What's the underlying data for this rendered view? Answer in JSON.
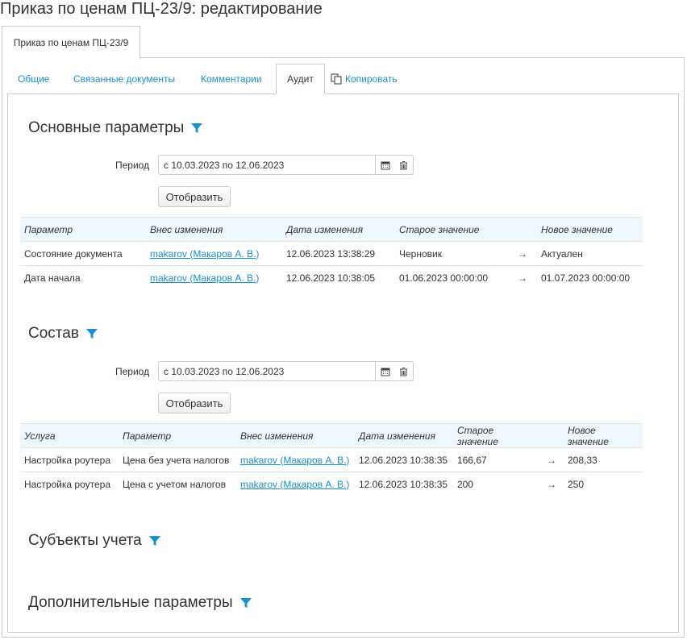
{
  "page_title": "Приказ по ценам ПЦ-23/9: редактирование",
  "outer_tab": "Приказ по ценам ПЦ-23/9",
  "tabs": [
    "Общие",
    "Связанные документы",
    "Комментарии",
    "Аудит",
    "Копировать"
  ],
  "active_tab": "Аудит",
  "sections": {
    "main_params": {
      "title": "Основные параметры",
      "period_label": "Период",
      "period_value": "с 10.03.2023 по 12.06.2023",
      "show_button": "Отобразить",
      "columns": [
        "Параметр",
        "Внес изменения",
        "Дата изменения",
        "Старое значение",
        "",
        "Новое значение"
      ],
      "rows": [
        [
          "Состояние документа",
          "makarov (Макаров А. В.)",
          "12.06.2023 13:38:29",
          "Черновик",
          "→",
          "Актуален"
        ],
        [
          "Дата начала",
          "makarov (Макаров А. В.)",
          "12.06.2023 10:38:05",
          "01.06.2023 00:00:00",
          "→",
          "01.07.2023 00:00:00"
        ]
      ]
    },
    "composition": {
      "title": "Состав",
      "period_label": "Период",
      "period_value": "с 10.03.2023 по 12.06.2023",
      "show_button": "Отобразить",
      "columns": [
        "Услуга",
        "Параметр",
        "Внес изменения",
        "Дата изменения",
        "Старое значение",
        "",
        "Новое значение"
      ],
      "rows": [
        [
          "Настройка роутера",
          "Цена без учета налогов",
          "makarov (Макаров А. В.)",
          "12.06.2023 10:38:35",
          "166,67",
          "→",
          "208,33"
        ],
        [
          "Настройка роутера",
          "Цена с учетом налогов",
          "makarov (Макаров А. В.)",
          "12.06.2023 10:38:35",
          "200",
          "→",
          "250"
        ]
      ]
    },
    "subjects": {
      "title": "Субъекты учета"
    },
    "additional": {
      "title": "Дополнительные параметры"
    }
  },
  "colors": {
    "accent": "#1a8fd0",
    "header_bg": "#eef7fc"
  }
}
